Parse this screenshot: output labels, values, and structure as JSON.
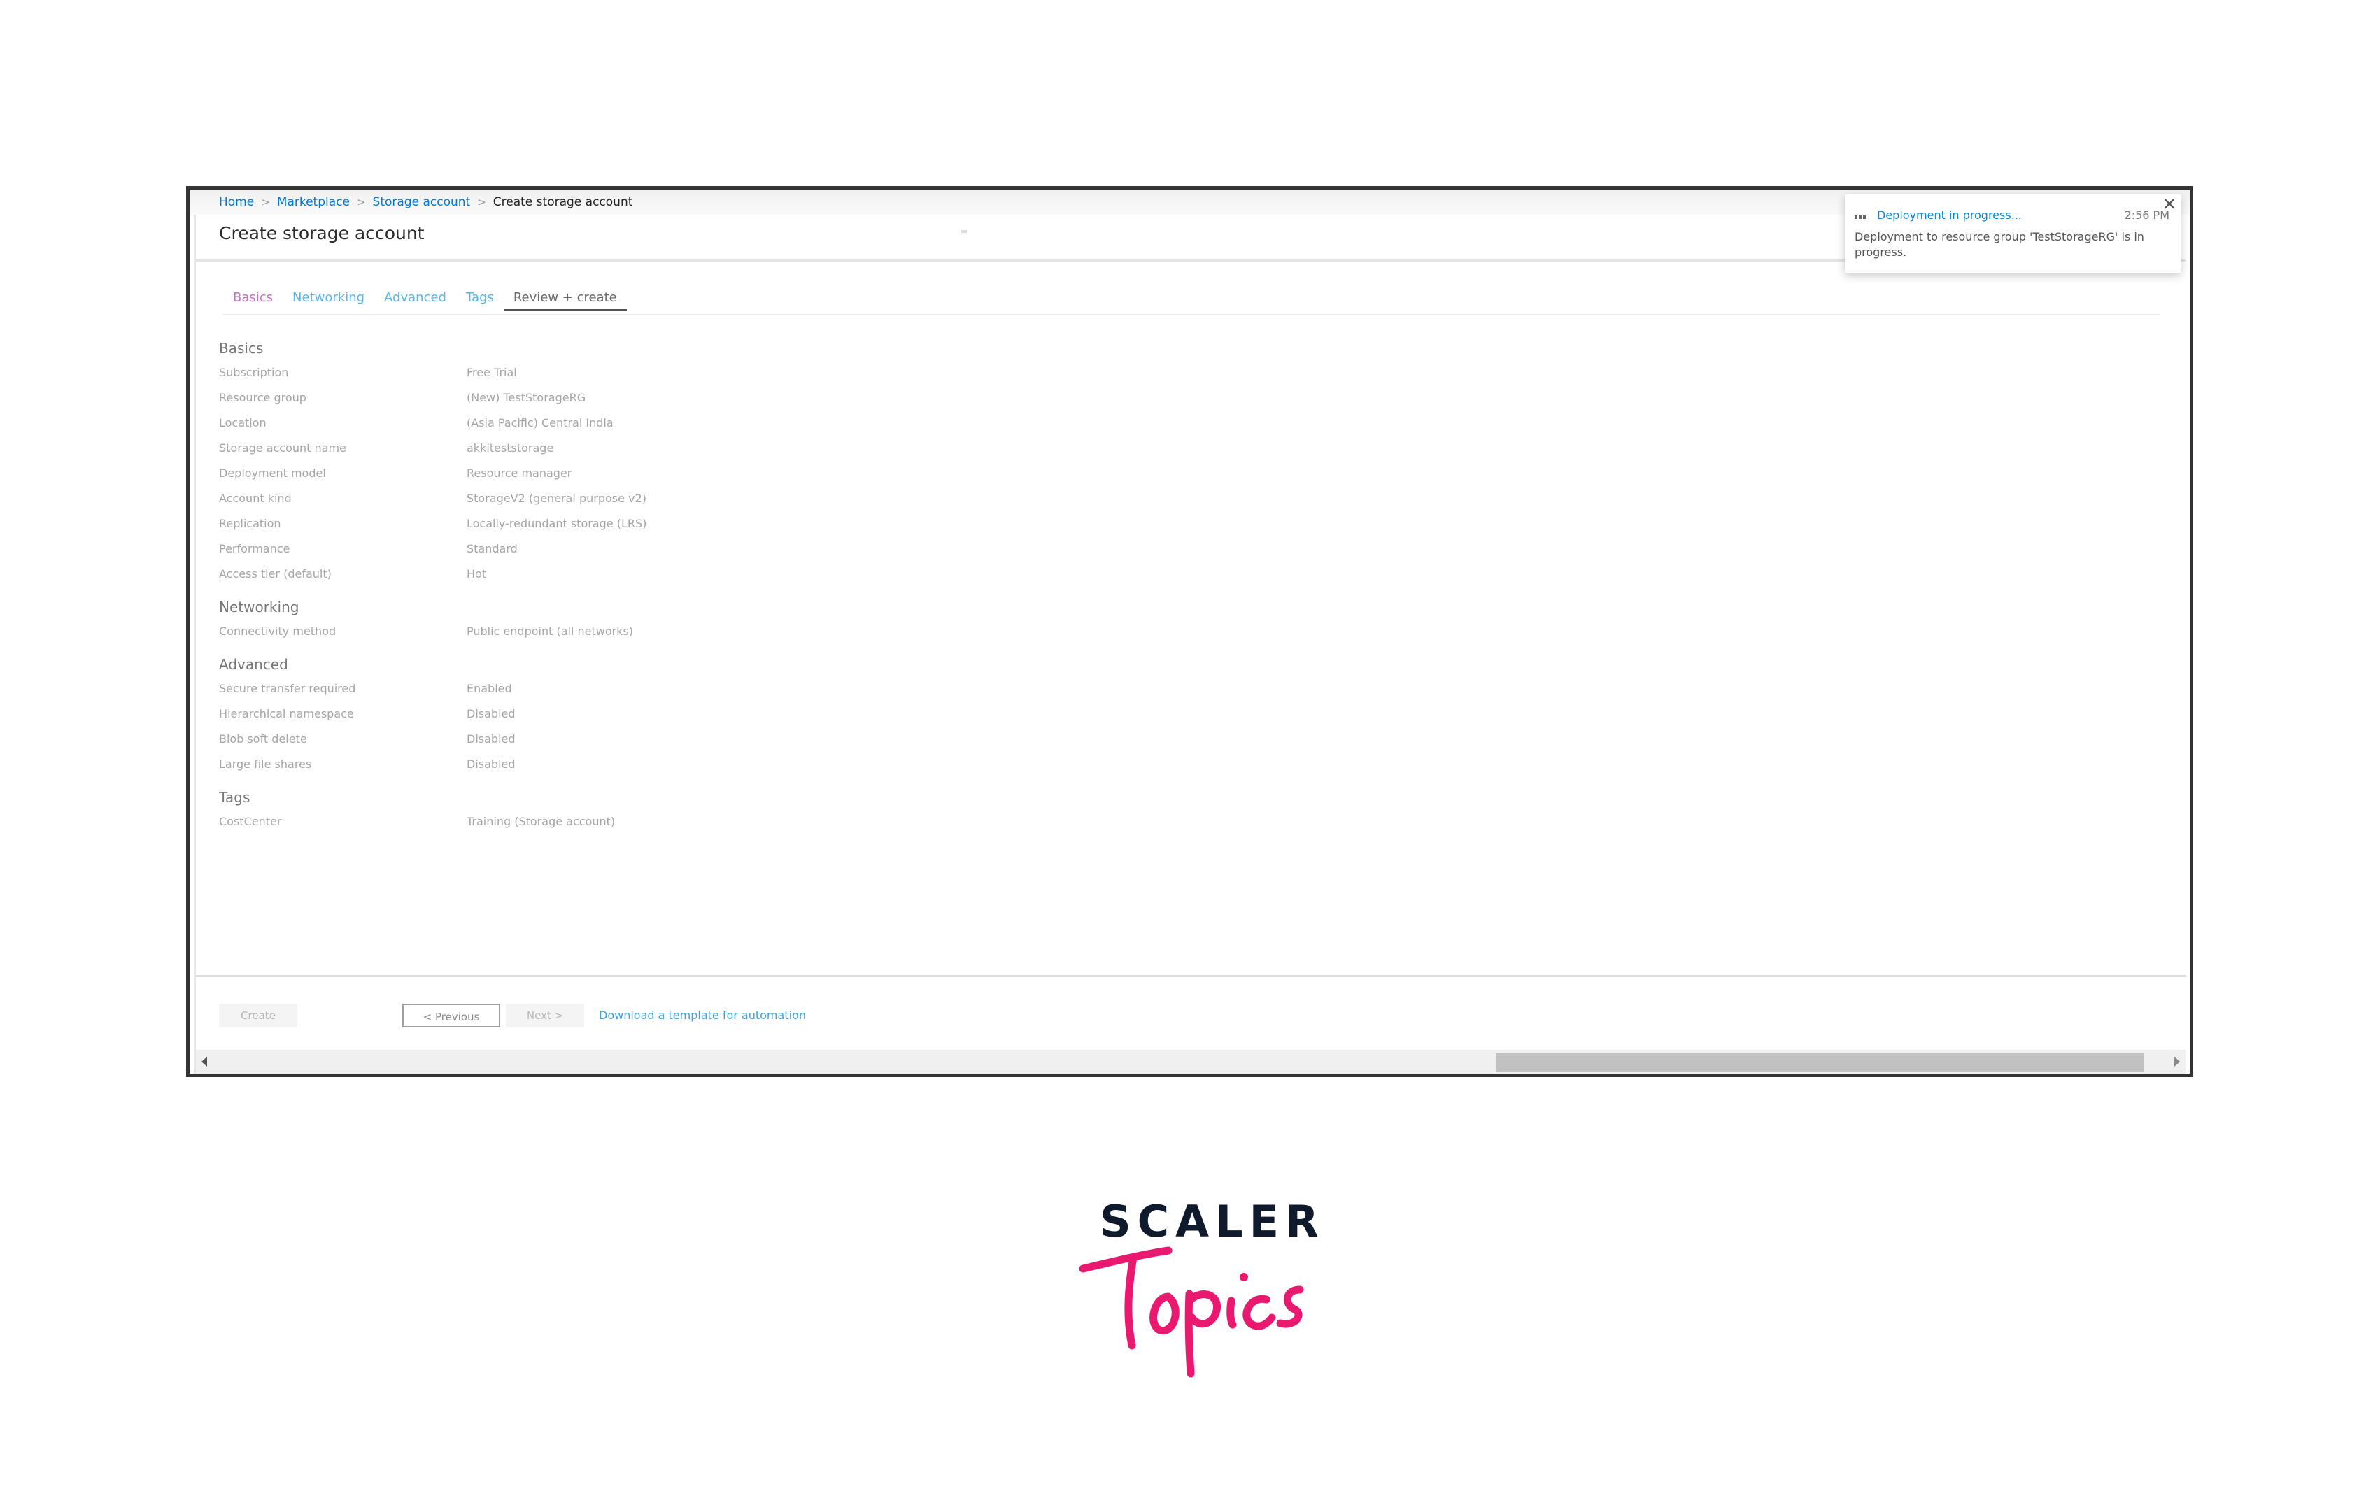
{
  "breadcrumb": {
    "items": [
      "Home",
      "Marketplace",
      "Storage account"
    ],
    "current": "Create storage account"
  },
  "page": {
    "title": "Create storage account"
  },
  "tabs": [
    {
      "label": "Basics",
      "state": "visited"
    },
    {
      "label": "Networking",
      "state": "link"
    },
    {
      "label": "Advanced",
      "state": "link"
    },
    {
      "label": "Tags",
      "state": "link"
    },
    {
      "label": "Review + create",
      "state": "active"
    }
  ],
  "summary": {
    "basics": {
      "title": "Basics",
      "rows": [
        {
          "label": "Subscription",
          "value": "Free Trial"
        },
        {
          "label": "Resource group",
          "value": "(New) TestStorageRG"
        },
        {
          "label": "Location",
          "value": "(Asia Pacific) Central India"
        },
        {
          "label": "Storage account name",
          "value": "akkiteststorage"
        },
        {
          "label": "Deployment model",
          "value": "Resource manager"
        },
        {
          "label": "Account kind",
          "value": "StorageV2 (general purpose v2)"
        },
        {
          "label": "Replication",
          "value": "Locally-redundant storage (LRS)"
        },
        {
          "label": "Performance",
          "value": "Standard"
        },
        {
          "label": "Access tier (default)",
          "value": "Hot"
        }
      ]
    },
    "networking": {
      "title": "Networking",
      "rows": [
        {
          "label": "Connectivity method",
          "value": "Public endpoint (all networks)"
        }
      ]
    },
    "advanced": {
      "title": "Advanced",
      "rows": [
        {
          "label": "Secure transfer required",
          "value": "Enabled"
        },
        {
          "label": "Hierarchical namespace",
          "value": "Disabled"
        },
        {
          "label": "Blob soft delete",
          "value": "Disabled"
        },
        {
          "label": "Large file shares",
          "value": "Disabled"
        }
      ]
    },
    "tags": {
      "title": "Tags",
      "rows": [
        {
          "label": "CostCenter",
          "value": "Training (Storage account)"
        }
      ]
    }
  },
  "footer": {
    "create_label": "Create",
    "previous_label": "< Previous",
    "next_label": "Next >",
    "download_link": "Download a template for automation"
  },
  "notification": {
    "icon": "progress-dots-icon",
    "title": "Deployment in progress...",
    "time": "2:56 PM",
    "body": "Deployment to resource group 'TestStorageRG' is in progress.",
    "close_icon": "close-icon"
  },
  "logo": {
    "line1": "SCALER",
    "line2": "Topics",
    "colors": {
      "scaler": "#0f1a2c",
      "topics": "#e8196f"
    }
  },
  "colors": {
    "link": "#0078d4",
    "tab_link": "#5bb5ea",
    "tab_visited": "#c46fc4",
    "notification_title": "#0a84d6"
  }
}
